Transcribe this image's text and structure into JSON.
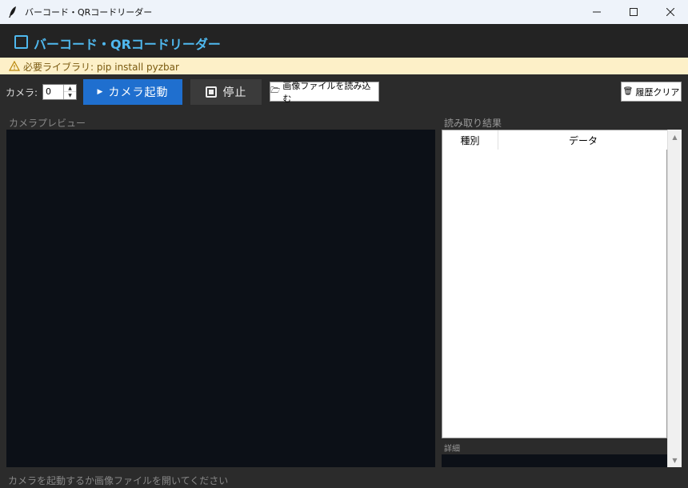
{
  "window": {
    "title": "バーコード・QRコードリーダー",
    "minimize": "—",
    "maximize": "☐",
    "close": "✕"
  },
  "header": {
    "title": "バーコード・QRコードリーダー"
  },
  "warning": {
    "text": "必要ライブラリ: pip install pyzbar"
  },
  "toolbar": {
    "camera_label": "カメラ:",
    "camera_index": "0",
    "start_label": "カメラ起動",
    "stop_label": "停止",
    "open_image_label": "画像ファイルを読み込む",
    "clear_history_label": "履歴クリア"
  },
  "preview": {
    "label": "カメラプレビュー"
  },
  "results": {
    "label": "読み取り結果",
    "columns": [
      "種別",
      "データ"
    ],
    "rows": []
  },
  "detail": {
    "label": "詳細"
  },
  "status": {
    "text": "カメラを起動するか画像ファイルを開いてください"
  },
  "colors": {
    "accent": "#4fb8ee",
    "primary_button": "#1f6fcf",
    "preview_bg": "#0c1017",
    "warning_bg": "#fdf0c8"
  }
}
